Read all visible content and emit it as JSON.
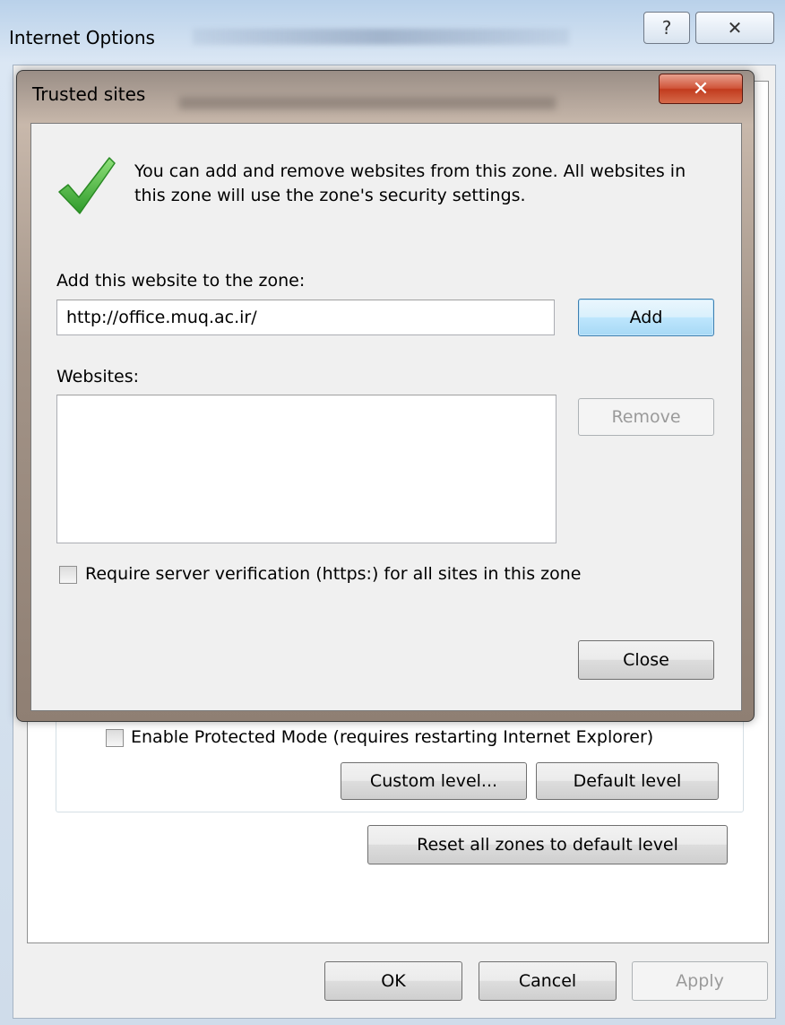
{
  "internet_options": {
    "title": "Internet Options",
    "help_glyph": "?",
    "close_glyph": "✕",
    "protected_mode_label": "Enable Protected Mode (requires restarting Internet Explorer)",
    "custom_level_label": "Custom level...",
    "default_level_label": "Default level",
    "reset_all_label": "Reset all zones to default level",
    "ok_label": "OK",
    "cancel_label": "Cancel",
    "apply_label": "Apply"
  },
  "trusted_sites": {
    "title": "Trusted sites",
    "close_glyph": "✕",
    "info_line1": "You can add and remove websites from this zone. All websites in",
    "info_line2": "this zone will use the zone's security settings.",
    "add_label": "Add this website to the zone:",
    "url_value": "http://office.muq.ac.ir/",
    "add_button": "Add",
    "websites_label": "Websites:",
    "websites": [],
    "remove_button": "Remove",
    "require_https_label": "Require server verification (https:) for all sites in this zone",
    "require_https_checked": false,
    "close_button": "Close",
    "icon": "green-checkmark-icon",
    "accent_color": "#4bb543"
  }
}
